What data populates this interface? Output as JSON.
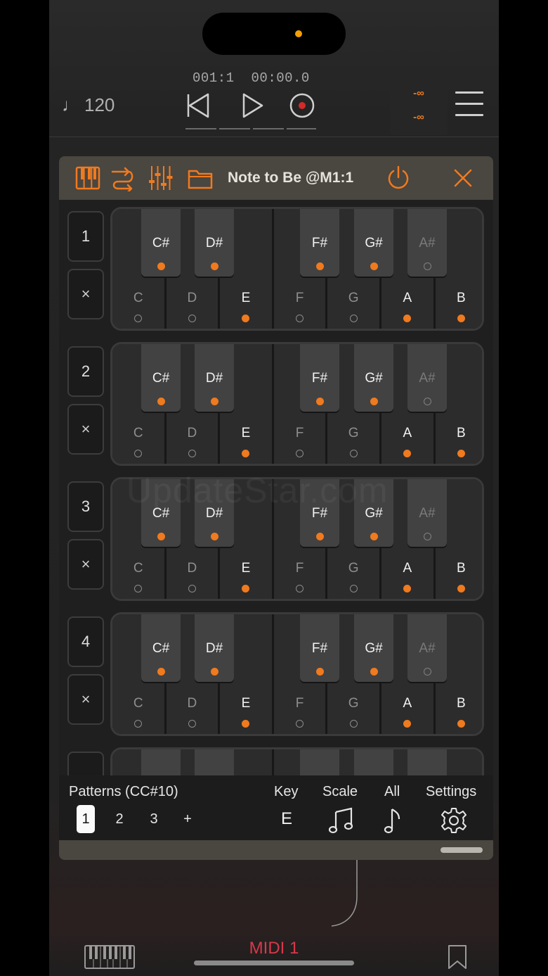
{
  "transport": {
    "tempo": "120",
    "bar_position": "001:1",
    "time": "00:00.0",
    "meter_top": "-∞",
    "meter_bottom": "-∞"
  },
  "plugin": {
    "title": "Note to Be @M1:1",
    "accent_color": "#f07a1e"
  },
  "rows": [
    {
      "number": "1",
      "clear": "×"
    },
    {
      "number": "2",
      "clear": "×"
    },
    {
      "number": "3",
      "clear": "×"
    },
    {
      "number": "4",
      "clear": "×"
    }
  ],
  "keys": {
    "white": [
      {
        "label": "C",
        "on": false
      },
      {
        "label": "D",
        "on": false
      },
      {
        "label": "E",
        "on": true
      },
      {
        "label": "F",
        "on": false
      },
      {
        "label": "G",
        "on": false
      },
      {
        "label": "A",
        "on": true
      },
      {
        "label": "B",
        "on": true
      }
    ],
    "black": [
      {
        "label": "C#",
        "on": true
      },
      {
        "label": "D#",
        "on": true
      },
      {
        "label": "F#",
        "on": true
      },
      {
        "label": "G#",
        "on": true
      },
      {
        "label": "A#",
        "on": false
      }
    ]
  },
  "controls": {
    "patterns_label": "Patterns (CC#10)",
    "pattern_tabs": [
      "1",
      "2",
      "3",
      "+"
    ],
    "key_label": "Key",
    "key_value": "E",
    "scale_label": "Scale",
    "all_label": "All",
    "settings_label": "Settings"
  },
  "bottom": {
    "title": "MIDI 1"
  },
  "watermark": "UpdateStar.com"
}
